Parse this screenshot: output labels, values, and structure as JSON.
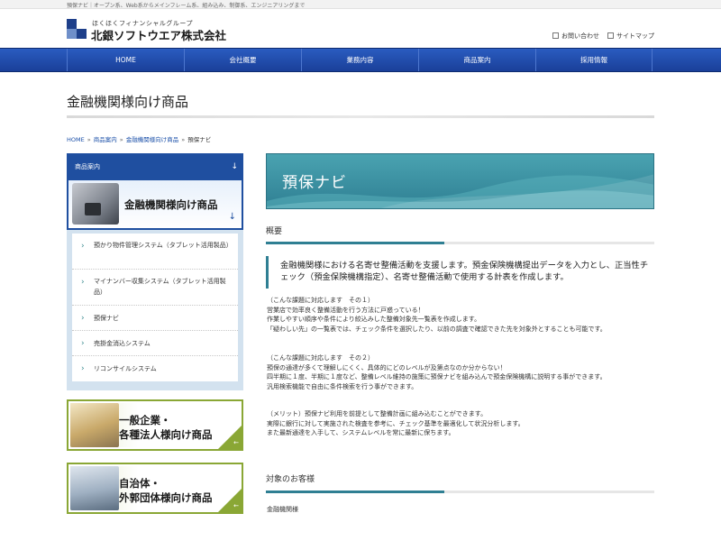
{
  "top_strip": {
    "text": "預保ナビ｜オープン系、Web系からメインフレーム系、組み込み、制御系、エンジニアリングまで"
  },
  "logo": {
    "group": "ほくほくフィナンシャルグループ",
    "company": "北銀ソフトウエア株式会社"
  },
  "utility_links": {
    "contact": "お問い合わせ",
    "sitemap": "サイトマップ"
  },
  "nav": {
    "items": [
      "HOME",
      "会社概要",
      "業務内容",
      "商品案内",
      "採用情報"
    ]
  },
  "page_title": "金融機関様向け商品",
  "breadcrumb": {
    "items": [
      "HOME",
      "商品案内",
      "金融機関様向け商品"
    ],
    "current": "預保ナビ"
  },
  "sidebar": {
    "heading": "商品案内",
    "banner_title": "金融機関様向け商品",
    "items": [
      {
        "label": "預かり物件管理システム（タブレット活用製品）"
      },
      {
        "label": "マイナンバー収集システム（タブレット活用製品）"
      },
      {
        "label": "預保ナビ"
      },
      {
        "label": "売掛金消込システム"
      },
      {
        "label": "リコンサイルシステム"
      }
    ],
    "banners": [
      {
        "line1": "一般企業・",
        "line2": "各種法人様向け商品"
      },
      {
        "line1": "自治体・",
        "line2": "外郭団体様向け商品"
      }
    ]
  },
  "main": {
    "hero_title": "預保ナビ",
    "overview_heading": "概要",
    "lead": "金融機関様における名寄せ整備活動を支援します。預金保険機構提出データを入力とし、正当性チェック（預金保険機構指定）、名寄せ整備活動で使用する計表を作成します。",
    "issue1": {
      "heading": "（こんな課題に対応します　その１）",
      "lines": [
        "営業店で効率良く整備活動を行う方法に戸惑っている！",
        "作業しやすい順序や条件により絞込みした整備対象先一覧表を作成します。",
        "「疑わしい先」の一覧表では、チェック条件を選択したり、以前の調査で確認できた先を対象外とすることも可能です。"
      ]
    },
    "issue2": {
      "heading": "（こんな課題に対応します　その２）",
      "lines": [
        "預保の通達が多くて理解しにくく、具体的にどのレベルが及第点なのか分からない！",
        "四半期に１度、半期に１度など、整備レベル維持の施策に預保ナビを組み込んで預金保険機構に説明する事ができます。",
        "汎用検索機能で自由に条件検索を行う事ができます。"
      ]
    },
    "merit": {
      "heading": "（メリット）預保ナビ利用を前提として整備計画に組み込むことができます。",
      "lines": [
        "実際に銀行に対して実施された検査を参考に、チェック基準を最適化して状況分析します。",
        "また最新通達を入手して、システムレベルを常に最新に保ちます。"
      ]
    },
    "customers_heading": "対象のお客様",
    "customers": "金融機関様"
  }
}
